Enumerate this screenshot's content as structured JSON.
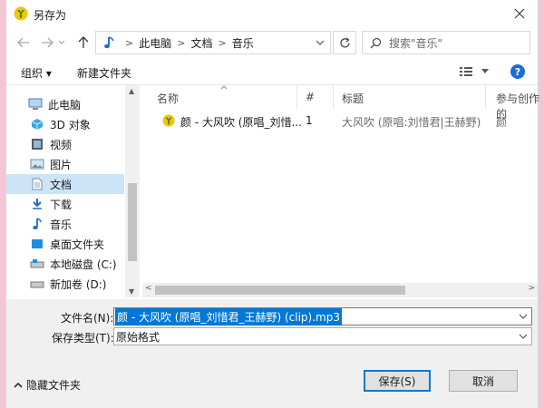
{
  "window": {
    "title": "另存为"
  },
  "address": {
    "segments": [
      "此电脑",
      "文档",
      "音乐"
    ],
    "search_placeholder": "搜索\"音乐\""
  },
  "toolbar": {
    "organize": "组织 ▾",
    "new_folder": "新建文件夹"
  },
  "nav": {
    "items": [
      {
        "label": "此电脑",
        "icon": "computer-icon"
      },
      {
        "label": "3D 对象",
        "icon": "cube-icon"
      },
      {
        "label": "视频",
        "icon": "video-icon"
      },
      {
        "label": "图片",
        "icon": "picture-icon"
      },
      {
        "label": "文档",
        "icon": "document-icon",
        "selected": true
      },
      {
        "label": "下载",
        "icon": "download-icon"
      },
      {
        "label": "音乐",
        "icon": "music-note-icon"
      },
      {
        "label": "桌面文件夹",
        "icon": "desktop-icon"
      },
      {
        "label": "本地磁盘 (C:)",
        "icon": "drive-icon"
      },
      {
        "label": "新加卷 (D:)",
        "icon": "drive-icon"
      }
    ]
  },
  "columns": {
    "name": "名称",
    "number": "#",
    "title": "标题",
    "artist": "参与创作的"
  },
  "files": [
    {
      "name": "颜 - 大风吹 (原唱_刘惜...",
      "number": "1",
      "title": "大风吹 (原唱:刘惜君|王赫野)",
      "artist": "颜"
    }
  ],
  "form": {
    "filename_label": "文件名(N):",
    "filename_value": "颜 - 大风吹 (原唱_刘惜君_王赫野) (clip).mp3",
    "type_label": "保存类型(T):",
    "type_value": "原始格式"
  },
  "buttons": {
    "save": "保存(S)",
    "cancel": "取消",
    "hide_folders": "隐藏文件夹"
  },
  "colors": {
    "accent": "#0078d7",
    "selection": "#cce4f7",
    "footer": "#f0f0f0"
  }
}
